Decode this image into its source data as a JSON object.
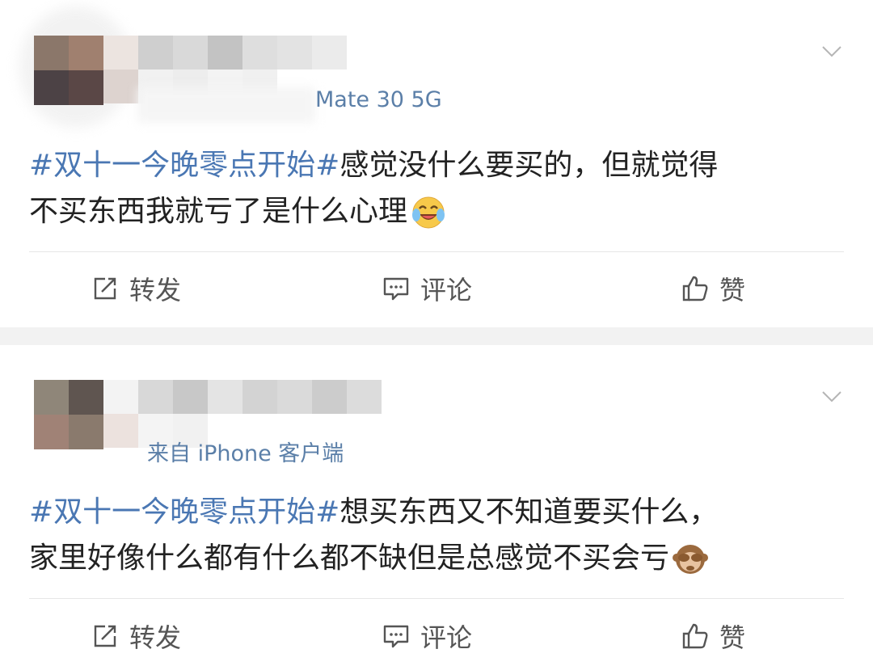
{
  "posts": [
    {
      "meta": "Mate 30 5G",
      "hashtag": "#双十一今晚零点开始#",
      "text_line1_rest": "感觉没什么要买的，但就觉得",
      "text_line2": "不买东西我就亏了是什么心理",
      "emoji": "laughing-crying-emoji",
      "actions": {
        "repost": "转发",
        "comment": "评论",
        "like": "赞"
      }
    },
    {
      "meta": "来自 iPhone 客户端",
      "hashtag": "#双十一今晚零点开始#",
      "text_line1_rest": "想买东西又不知道要买什么，",
      "text_line2": "家里好像什么都有什么都不缺但是总感觉不买会亏",
      "emoji": "see-no-evil-monkey-emoji",
      "actions": {
        "repost": "转发",
        "comment": "评论",
        "like": "赞"
      }
    }
  ],
  "colors": {
    "hashtag": "#4a77b3",
    "meta": "#5b7fa8",
    "separator": "#f2f2f2"
  }
}
